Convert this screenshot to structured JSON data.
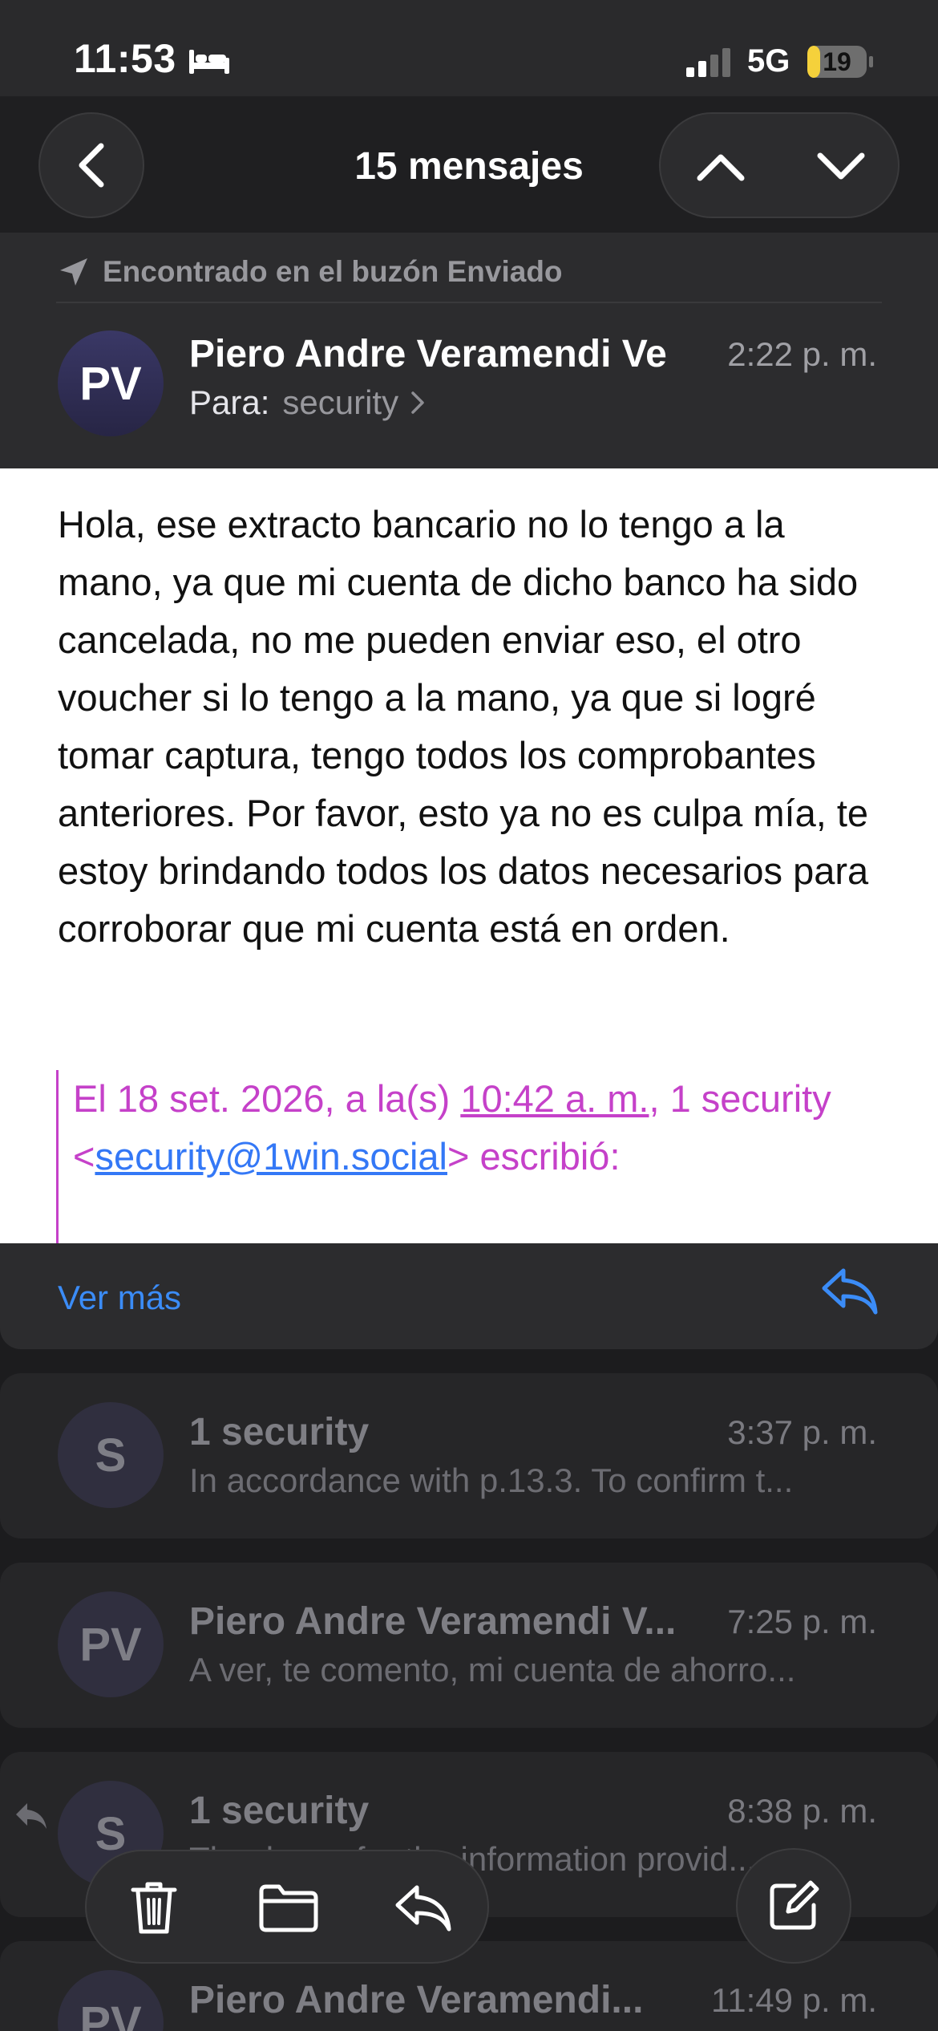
{
  "status_bar": {
    "time": "11:53",
    "network": "5G",
    "battery": "19"
  },
  "nav": {
    "title": "15 mensajes"
  },
  "message": {
    "found_in": "Encontrado en el buzón Enviado",
    "avatar_initials": "PV",
    "sender": "Piero Andre Veramendi Ve",
    "time": "2:22 p. m.",
    "to_label": "Para:",
    "to_value": "security",
    "body": "Hola, ese extracto bancario no lo tengo a la mano, ya que mi cuenta de dicho banco ha sido cancelada, no me pueden enviar eso, el otro voucher si lo tengo a la mano, ya que si logré tomar captura, tengo todos los comprobantes anteriores. Por favor, esto ya no es culpa mía, te estoy brindando todos los datos necesarios para corroborar que mi cuenta está en orden.",
    "quote": {
      "prefix": "El 18 set. 2026, a la(s) ",
      "time": "10:42 a. m.",
      "middle": ", 1 security",
      "lt": "<",
      "email": "security@1win.social",
      "suffix": "> escribió:"
    },
    "ver_mas": "Ver más"
  },
  "thread": [
    {
      "initials": "S",
      "sender": "1 security",
      "time": "3:37 p. m.",
      "snippet": "In accordance with p.13.3. To confirm t..."
    },
    {
      "initials": "PV",
      "sender": "Piero Andre Veramendi V...",
      "time": "7:25 p. m.",
      "snippet": "A ver, te comento, mi cuenta de ahorro..."
    },
    {
      "initials": "S",
      "sender": "1 security",
      "time": "8:38 p. m.",
      "snippet": "Thank you for the information provid..."
    },
    {
      "initials": "PV",
      "sender": "Piero Andre Veramendi...",
      "time": "11:49 p. m.",
      "snippet": ""
    }
  ],
  "icons": {
    "back": "chevron-left-icon",
    "up": "chevron-up-icon",
    "down": "chevron-down-icon",
    "trash": "trash-icon",
    "folder": "folder-icon",
    "reply": "reply-icon",
    "compose": "compose-icon"
  },
  "colors": {
    "accent": "#3b8cf7",
    "quote": "#c541c9",
    "battery": "#f5d13b"
  }
}
